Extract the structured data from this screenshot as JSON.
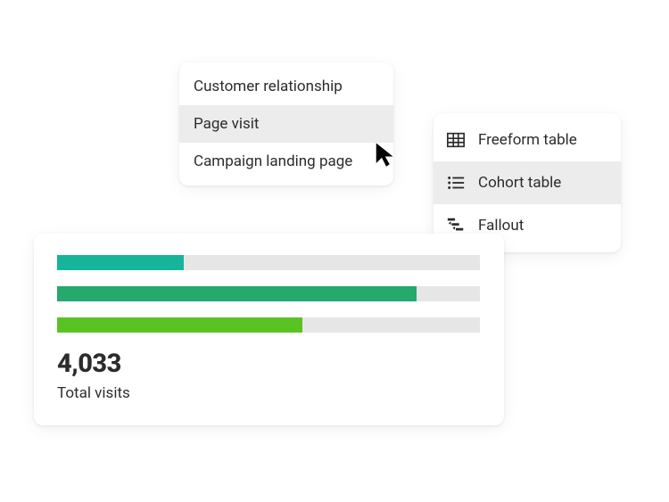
{
  "menu_left": {
    "items": [
      {
        "label": "Customer relationship",
        "selected": false
      },
      {
        "label": "Page visit",
        "selected": true
      },
      {
        "label": "Campaign landing page",
        "selected": false
      }
    ]
  },
  "menu_right": {
    "items": [
      {
        "icon": "table-icon",
        "label": "Freeform table",
        "selected": false
      },
      {
        "icon": "list-icon",
        "label": "Cohort table",
        "selected": true
      },
      {
        "icon": "fallout-icon",
        "label": "Fallout",
        "selected": false
      }
    ]
  },
  "stats": {
    "metric_value": "4,033",
    "metric_label": "Total visits"
  },
  "chart_data": {
    "type": "bar",
    "orientation": "horizontal",
    "categories": [
      "bar1",
      "bar2",
      "bar3"
    ],
    "values": [
      30,
      85,
      58
    ],
    "colors": [
      "#16b59b",
      "#26a96c",
      "#5ac324"
    ],
    "xlim": [
      0,
      100
    ],
    "title": "",
    "xlabel": "",
    "ylabel": ""
  }
}
